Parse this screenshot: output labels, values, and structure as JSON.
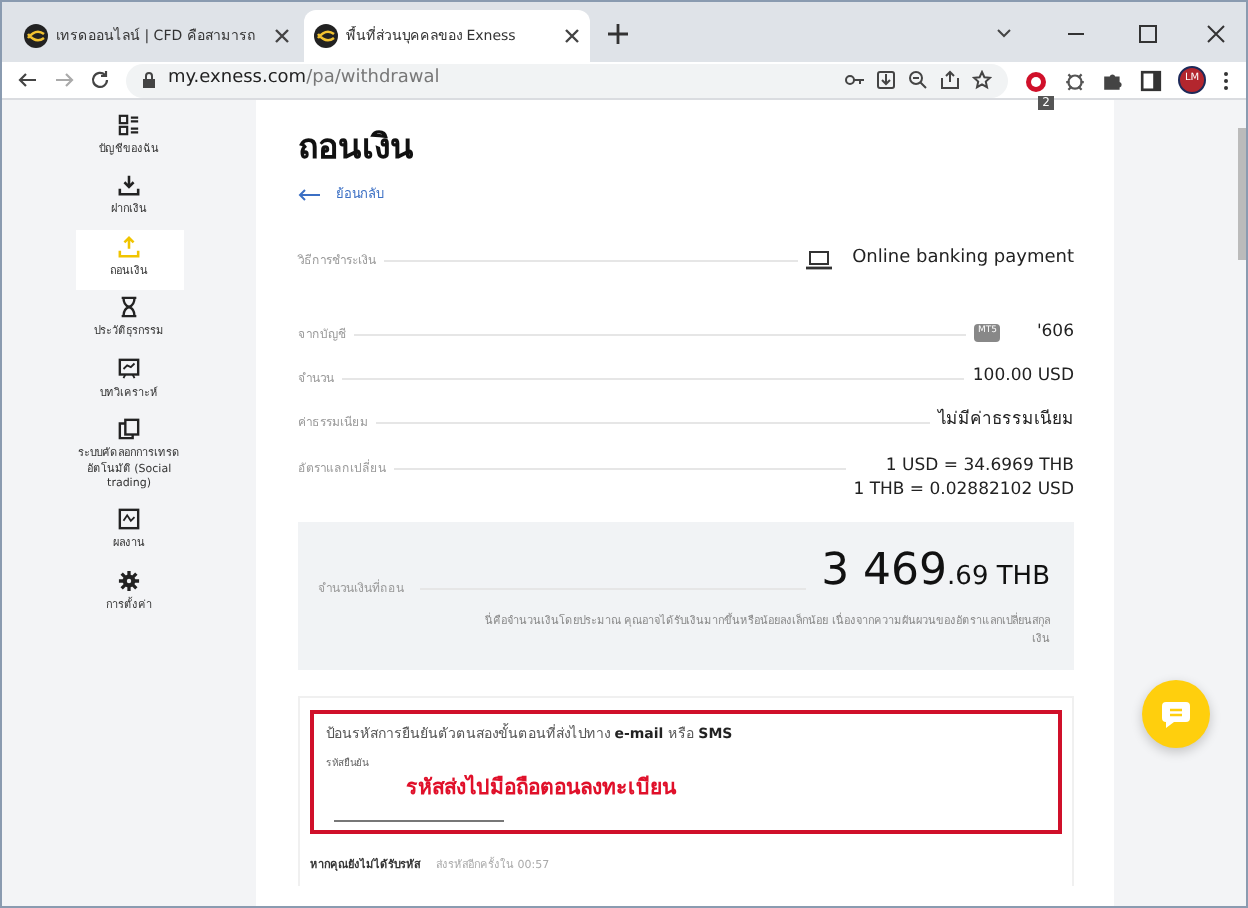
{
  "browser": {
    "tabs": [
      {
        "title": "เทรดออนไลน์ | CFD คือสามารถ",
        "selected": false
      },
      {
        "title": "พื้นที่ส่วนบุคคลของ Exness",
        "selected": true
      }
    ],
    "url": {
      "host": "my.exness.com",
      "path": "/pa/withdrawal"
    },
    "extension_badge": "2",
    "profile_initials": "LM"
  },
  "sidebar": {
    "items": [
      {
        "label": "บัญชีของฉัน",
        "selected": false
      },
      {
        "label": "ฝากเงิน",
        "selected": false
      },
      {
        "label": "ถอนเงิน",
        "selected": true
      },
      {
        "label": "ประวัติธุรกรรม",
        "selected": false
      },
      {
        "label": "บทวิเคราะห์",
        "selected": false
      },
      {
        "label": "ระบบคัดลอกการเทรดอัตโนมัติ (Social trading)",
        "selected": false
      },
      {
        "label": "ผลงาน",
        "selected": false
      },
      {
        "label": "การตั้งค่า",
        "selected": false
      }
    ]
  },
  "page": {
    "title": "ถอนเงิน",
    "back_link": "ย้อนกลับ",
    "details": [
      {
        "kind": "method",
        "label": "วิธีการชำระเงิน",
        "values": [
          "Online banking payment"
        ]
      },
      {
        "kind": "account",
        "label": "จากบัญชี",
        "badge": "MT5",
        "values": [
          "'606"
        ]
      },
      {
        "kind": "plain",
        "label": "จำนวน",
        "values": [
          "100.00 USD"
        ]
      },
      {
        "kind": "plain",
        "label": "ค่าธรรมเนียม",
        "values": [
          "ไม่มีค่าธรรมเนียม"
        ]
      },
      {
        "kind": "plain",
        "label": "อัตราแลกเปลี่ยน",
        "values": [
          "1 USD = 34.6969 THB",
          "1 THB = 0.02882102 USD"
        ]
      }
    ],
    "summary": {
      "label": "จำนวนเงินที่ถอน",
      "amount_whole": "3 469",
      "amount_fraction": ".69 THB",
      "note": "นี่คือจำนวนเงินโดยประมาณ คุณอาจได้รับเงินมากขึ้นหรือน้อยลงเล็กน้อย เนื่องจากความผันผวนของอัตราแลกเปลี่ยนสกุลเงิน"
    },
    "verification": {
      "instruction": "ป้อนรหัสการยืนยันตัวตนสองขั้นตอนที่ส่งไปทาง **e-mail** หรือ **SMS**",
      "field_label": "รหัสยืนยัน",
      "annotation": "รหัสส่งไปมือถือตอนลงทะเบียน",
      "resend_prompt": "หากคุณยังไม่ได้รับรหัส",
      "resend_timer": "ส่งรหัสอีกครั้งใน 00:57"
    }
  }
}
